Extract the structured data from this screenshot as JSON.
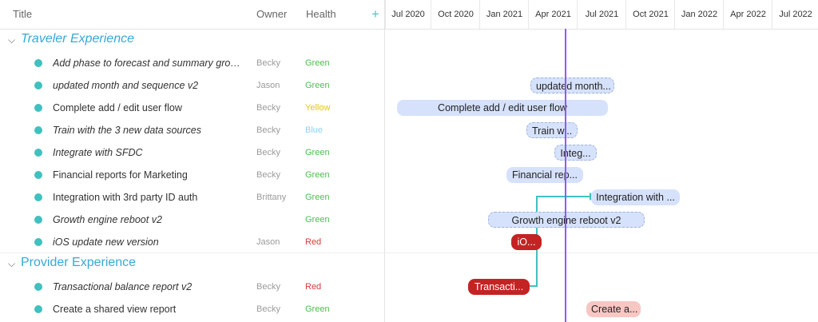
{
  "columns": {
    "title": "Title",
    "owner": "Owner",
    "health": "Health",
    "add": "+"
  },
  "months": [
    "Jul 2020",
    "Oct 2020",
    "Jan 2021",
    "Apr 2021",
    "Jul 2021",
    "Oct 2021",
    "Jan 2022",
    "Apr 2022",
    "Jul 2022"
  ],
  "groups": [
    {
      "name": "Traveler Experience",
      "items": [
        {
          "title": "Add phase to forecast and summary group ...",
          "owner": "Becky",
          "health": "Green",
          "bar": ""
        },
        {
          "title": "updated month and sequence v2",
          "owner": "Jason",
          "health": "Green",
          "bar": "updated month..."
        },
        {
          "title": "Complete add / edit user flow",
          "owner": "Becky",
          "health": "Yellow",
          "bar": "Complete add / edit user flow"
        },
        {
          "title": "Train with the 3 new data sources",
          "owner": "Becky",
          "health": "Blue",
          "bar": "Train w..."
        },
        {
          "title": "Integrate with SFDC",
          "owner": "Becky",
          "health": "Green",
          "bar": "Integ..."
        },
        {
          "title": "Financial reports for Marketing",
          "owner": "Becky",
          "health": "Green",
          "bar": "Financial rep..."
        },
        {
          "title": "Integration with 3rd party ID auth",
          "owner": "Brittany",
          "health": "Green",
          "bar": "Integration with ..."
        },
        {
          "title": "Growth engine reboot v2",
          "owner": "",
          "health": "Green",
          "bar": "Growth engine reboot v2"
        },
        {
          "title": "iOS update new version",
          "owner": "Jason",
          "health": "Red",
          "bar": "iO..."
        }
      ]
    },
    {
      "name": "Provider Experience",
      "items": [
        {
          "title": "Transactional balance report v2",
          "owner": "Becky",
          "health": "Red",
          "bar": "Transacti..."
        },
        {
          "title": "Create a shared view report",
          "owner": "Becky",
          "health": "Green",
          "bar": "Create a..."
        }
      ]
    }
  ],
  "health_colors": {
    "Green": "#4cbf4c",
    "Yellow": "#e6c619",
    "Blue": "#8fd3f0",
    "Red": "#d93a3a"
  },
  "colors": {
    "accent": "#38a9d6",
    "dot": "#40c1bf",
    "today_line": "#8b5cf6",
    "bar_blue": "#d6e2fb",
    "bar_red": "#c42323",
    "bar_pink": "#f8c6c3"
  }
}
